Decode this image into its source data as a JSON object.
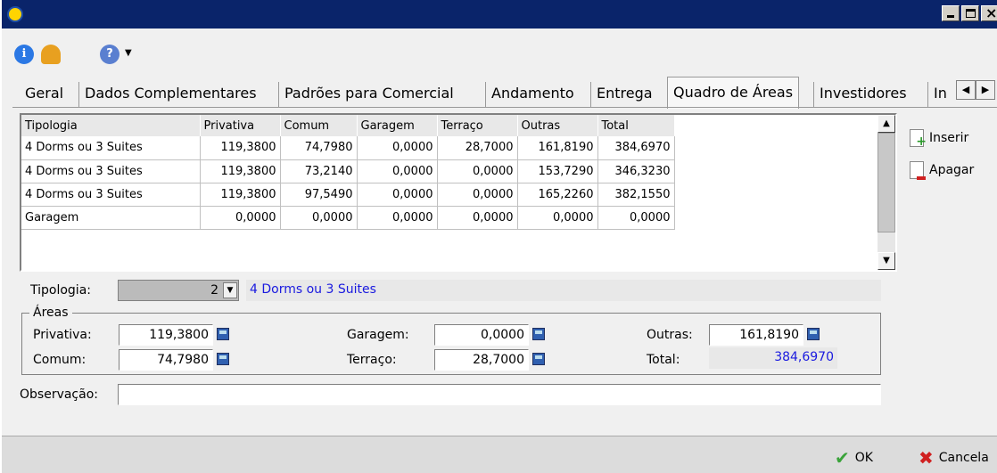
{
  "toolbar": {
    "info_icon": "info-icon",
    "user_icon": "user-icon",
    "help_icon": "help-icon"
  },
  "tabs": [
    "Geral",
    "Dados Complementares",
    "Padrões para Comercial",
    "Andamento",
    "Entrega",
    "Quadro de Áreas",
    "Investidores",
    "In"
  ],
  "active_tab": "Quadro de Áreas",
  "grid": {
    "columns": [
      "Tipologia",
      "Privativa",
      "Comum",
      "Garagem",
      "Terraço",
      "Outras",
      "Total"
    ],
    "rows": [
      [
        "4 Dorms ou 3 Suites",
        "119,3800",
        "74,7980",
        "0,0000",
        "28,7000",
        "161,8190",
        "384,6970"
      ],
      [
        "4 Dorms ou 3 Suites",
        "119,3800",
        "73,2140",
        "0,0000",
        "0,0000",
        "153,7290",
        "346,3230"
      ],
      [
        "4 Dorms ou 3 Suites",
        "119,3800",
        "97,5490",
        "0,0000",
        "0,0000",
        "165,2260",
        "382,1550"
      ],
      [
        "Garagem",
        "0,0000",
        "0,0000",
        "0,0000",
        "0,0000",
        "0,0000",
        "0,0000"
      ]
    ]
  },
  "actions": {
    "insert": "Inserir",
    "delete": "Apagar"
  },
  "form": {
    "tipologia_label": "Tipologia:",
    "tipologia_value": "2",
    "tipologia_desc": "4 Dorms ou 3 Suites",
    "areas_legend": "Áreas",
    "privativa_label": "Privativa:",
    "privativa_value": "119,3800",
    "comum_label": "Comum:",
    "comum_value": "74,7980",
    "garagem_label": "Garagem:",
    "garagem_value": "0,0000",
    "terraco_label": "Terraço:",
    "terraco_value": "28,7000",
    "outras_label": "Outras:",
    "outras_value": "161,8190",
    "total_label": "Total:",
    "total_value": "384,6970",
    "observacao_label": "Observação:",
    "observacao_value": ""
  },
  "footer": {
    "ok": "OK",
    "cancel": "Cancela"
  }
}
